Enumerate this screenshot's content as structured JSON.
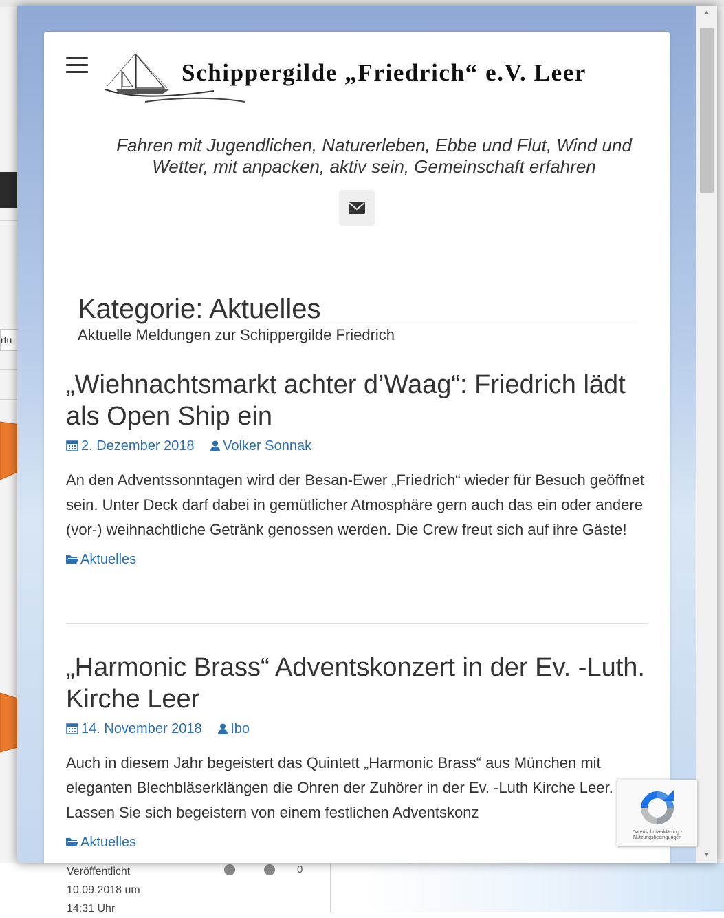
{
  "background_app": {
    "field_fragment": "rtu",
    "published_label": "Veröffentlicht",
    "published_date": "10.09.2018 um",
    "published_time": "14:31 Uhr",
    "comment_count": "0"
  },
  "site": {
    "title": "Schippergilde „Friedrich“ e.V. Leer",
    "tagline": "Fahren mit Jugendlichen, Naturerleben, Ebbe und Flut, Wind und Wetter, mit anpacken, aktiv sein, Gemeinschaft erfahren",
    "mail_icon": "envelope-icon",
    "menu_icon": "hamburger-icon"
  },
  "category": {
    "title": "Kategorie: Aktuelles",
    "description": "Aktuelle Meldungen zur Schippergilde Friedrich"
  },
  "posts": [
    {
      "title": "„Wiehnachtsmarkt achter d’Waag“: Friedrich lädt als Open Ship ein",
      "date": "2. Dezember 2018",
      "author": "Volker Sonnak",
      "excerpt": "An den Adventssonntagen wird der Besan-Ewer „Friedrich“ wieder für Besuch geöffnet sein. Unter Deck darf dabei in gemütlicher Atmosphäre gern auch das ein oder andere (vor-) weihnachtliche Getränk genossen werden. Die Crew freut sich auf ihre Gäste!",
      "category": "Aktuelles"
    },
    {
      "title": "„Harmonic Brass“ Adventskonzert in der Ev. -Luth. Kirche Leer",
      "date": "14. November 2018",
      "author": "Ibo",
      "excerpt": "Auch in diesem Jahr begeistert das Quintett „Harmonic Brass“ aus München mit eleganten Blechbläserklängen die Ohren der Zuhörer in der Ev. -Luth Kirche Leer. Lassen Sie sich begeistern von einem festlichen Adventskonz",
      "category": "Aktuelles"
    }
  ],
  "recaptcha": {
    "footer_text": "Datenschutzerklärung - Nutzungsbedingungen"
  },
  "colors": {
    "link": "#2a6fb0",
    "arrow": "#ea7a2c",
    "text": "#333333"
  }
}
